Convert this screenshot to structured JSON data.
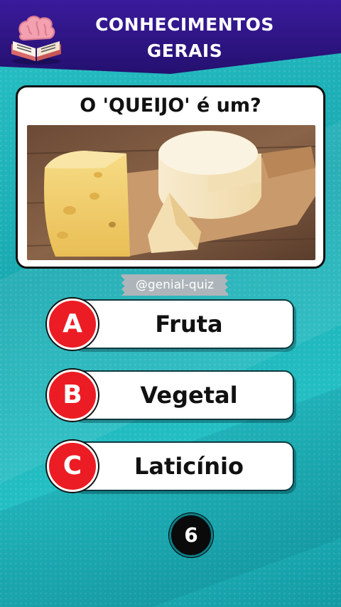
{
  "header": {
    "title_line1": "CONHECIMENTOS",
    "title_line2": "GERAIS",
    "logo_icon": "brain-book-icon"
  },
  "question": {
    "text": "O 'QUEIJO' é um?",
    "image_icon": "cheese-photo"
  },
  "watermark": "@genial-quiz",
  "options": [
    {
      "letter": "A",
      "label": "Fruta"
    },
    {
      "letter": "B",
      "label": "Vegetal"
    },
    {
      "letter": "C",
      "label": "Laticínio"
    }
  ],
  "timer": "6",
  "colors": {
    "header": "#2b1484",
    "background": "#1fb8bd",
    "badge": "#ec1c24"
  }
}
